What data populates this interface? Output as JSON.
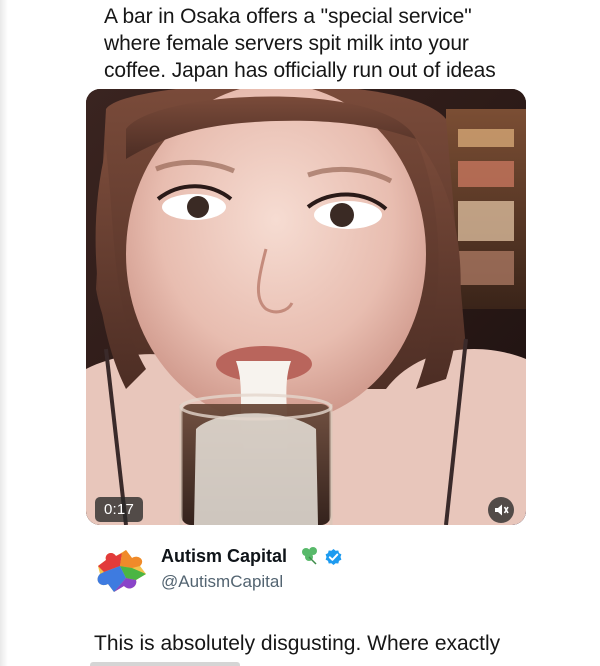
{
  "post": {
    "lines": [
      "A bar in Osaka offers a \"special service\"",
      "where female servers spit milk into your",
      "coffee. Japan has officially run out of ideas"
    ]
  },
  "video": {
    "duration": "0:17",
    "mute_icon": "muted-speaker-icon"
  },
  "author": {
    "name": "Autism Capital",
    "handle": "@AutismCapital",
    "avatar_icon": "rainbow-puzzle-icon",
    "badges": [
      "clover-icon",
      "verified-icon"
    ]
  },
  "reply": {
    "text": "This is absolutely disgusting. Where exactly"
  },
  "colors": {
    "verified": "#1d9bf0",
    "handle": "#536471"
  }
}
